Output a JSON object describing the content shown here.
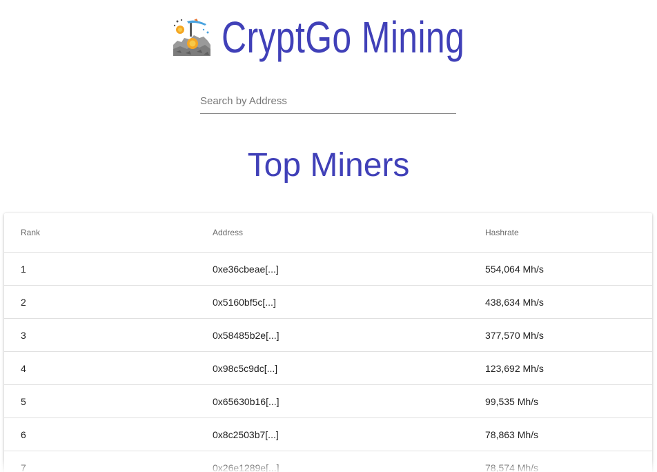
{
  "header": {
    "title": "CryptGo Mining",
    "logo_icon": "mining-pick-icon"
  },
  "search": {
    "placeholder": "Search by Address",
    "value": ""
  },
  "section": {
    "title": "Top Miners"
  },
  "table": {
    "columns": [
      "Rank",
      "Address",
      "Hashrate"
    ],
    "rows": [
      {
        "rank": "1",
        "address": "0xe36cbeae[...]",
        "hashrate": "554,064 Mh/s"
      },
      {
        "rank": "2",
        "address": "0x5160bf5c[...]",
        "hashrate": "438,634 Mh/s"
      },
      {
        "rank": "3",
        "address": "0x58485b2e[...]",
        "hashrate": "377,570 Mh/s"
      },
      {
        "rank": "4",
        "address": "0x98c5c9dc[...]",
        "hashrate": "123,692 Mh/s"
      },
      {
        "rank": "5",
        "address": "0x65630b16[...]",
        "hashrate": "99,535 Mh/s"
      },
      {
        "rank": "6",
        "address": "0x8c2503b7[...]",
        "hashrate": "78,863 Mh/s"
      },
      {
        "rank": "7",
        "address": "0x26e1289e[...]",
        "hashrate": "78,574 Mh/s"
      }
    ]
  },
  "colors": {
    "brand": "#4040b8",
    "divider": "#e0e0e0"
  }
}
